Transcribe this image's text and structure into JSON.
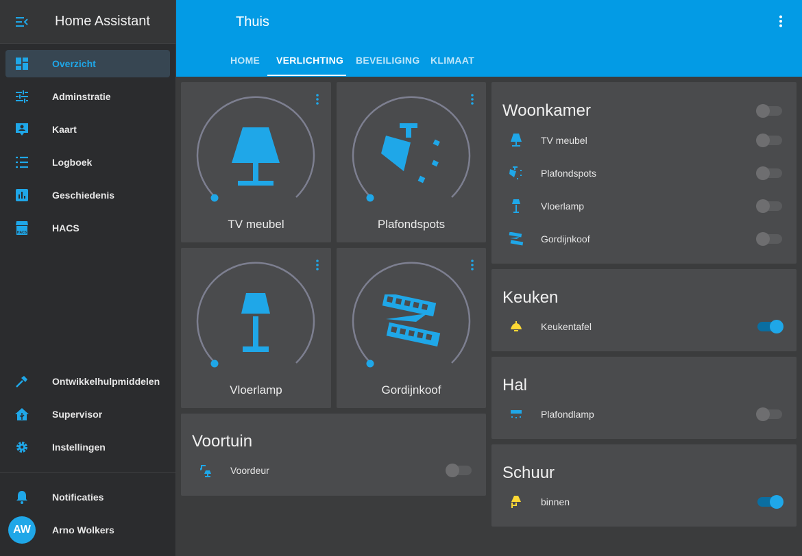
{
  "sidebar": {
    "title": "Home Assistant",
    "items": [
      {
        "label": "Overzicht",
        "icon": "dashboard-icon"
      },
      {
        "label": "Adminstratie",
        "icon": "tune-icon"
      },
      {
        "label": "Kaart",
        "icon": "map-account-icon"
      },
      {
        "label": "Logboek",
        "icon": "list-icon"
      },
      {
        "label": "Geschiedenis",
        "icon": "chart-box-icon"
      },
      {
        "label": "HACS",
        "icon": "hacs-icon"
      }
    ],
    "bottom_items": [
      {
        "label": "Ontwikkelhulpmiddelen",
        "icon": "hammer-icon"
      },
      {
        "label": "Supervisor",
        "icon": "home-assistant-icon"
      },
      {
        "label": "Instellingen",
        "icon": "gear-icon"
      }
    ],
    "notifications": "Notificaties",
    "user": {
      "initials": "AW",
      "name": "Arno Wolkers"
    }
  },
  "header": {
    "title": "Thuis",
    "tabs": [
      "HOME",
      "VERLICHTING",
      "BEVEILIGING",
      "KLIMAAT"
    ],
    "active_tab": "VERLICHTING"
  },
  "light_cards": [
    {
      "name": "TV meubel",
      "icon": "table-lamp-icon"
    },
    {
      "name": "Plafondspots",
      "icon": "spotlight-icon"
    },
    {
      "name": "Vloerlamp",
      "icon": "floor-lamp-icon"
    },
    {
      "name": "Gordijnkoof",
      "icon": "led-strip-icon"
    }
  ],
  "voortuin": {
    "title": "Voortuin",
    "entities": [
      {
        "name": "Voordeur",
        "icon": "outdoor-lamp-icon",
        "state": "off"
      }
    ]
  },
  "woonkamer": {
    "title": "Woonkamer",
    "header_toggle": "off",
    "entities": [
      {
        "name": "TV meubel",
        "icon": "table-lamp-icon",
        "state": "off"
      },
      {
        "name": "Plafondspots",
        "icon": "spotlight-icon",
        "state": "off"
      },
      {
        "name": "Vloerlamp",
        "icon": "floor-lamp-icon",
        "state": "off"
      },
      {
        "name": "Gordijnkoof",
        "icon": "led-strip-icon",
        "state": "off"
      }
    ]
  },
  "keuken": {
    "title": "Keuken",
    "entities": [
      {
        "name": "Keukentafel",
        "icon": "ceiling-light-icon",
        "state": "on"
      }
    ]
  },
  "hal": {
    "title": "Hal",
    "entities": [
      {
        "name": "Plafondlamp",
        "icon": "ceiling-light-flat-icon",
        "state": "off"
      }
    ]
  },
  "schuur": {
    "title": "Schuur",
    "entities": [
      {
        "name": "binnen",
        "icon": "wall-light-icon",
        "state": "on"
      }
    ]
  },
  "colors": {
    "accent": "#039be5",
    "icon": "#1fa7e8",
    "on_icon": "#fdd835",
    "card": "#4a4b4d",
    "background": "#3b3c3d"
  }
}
